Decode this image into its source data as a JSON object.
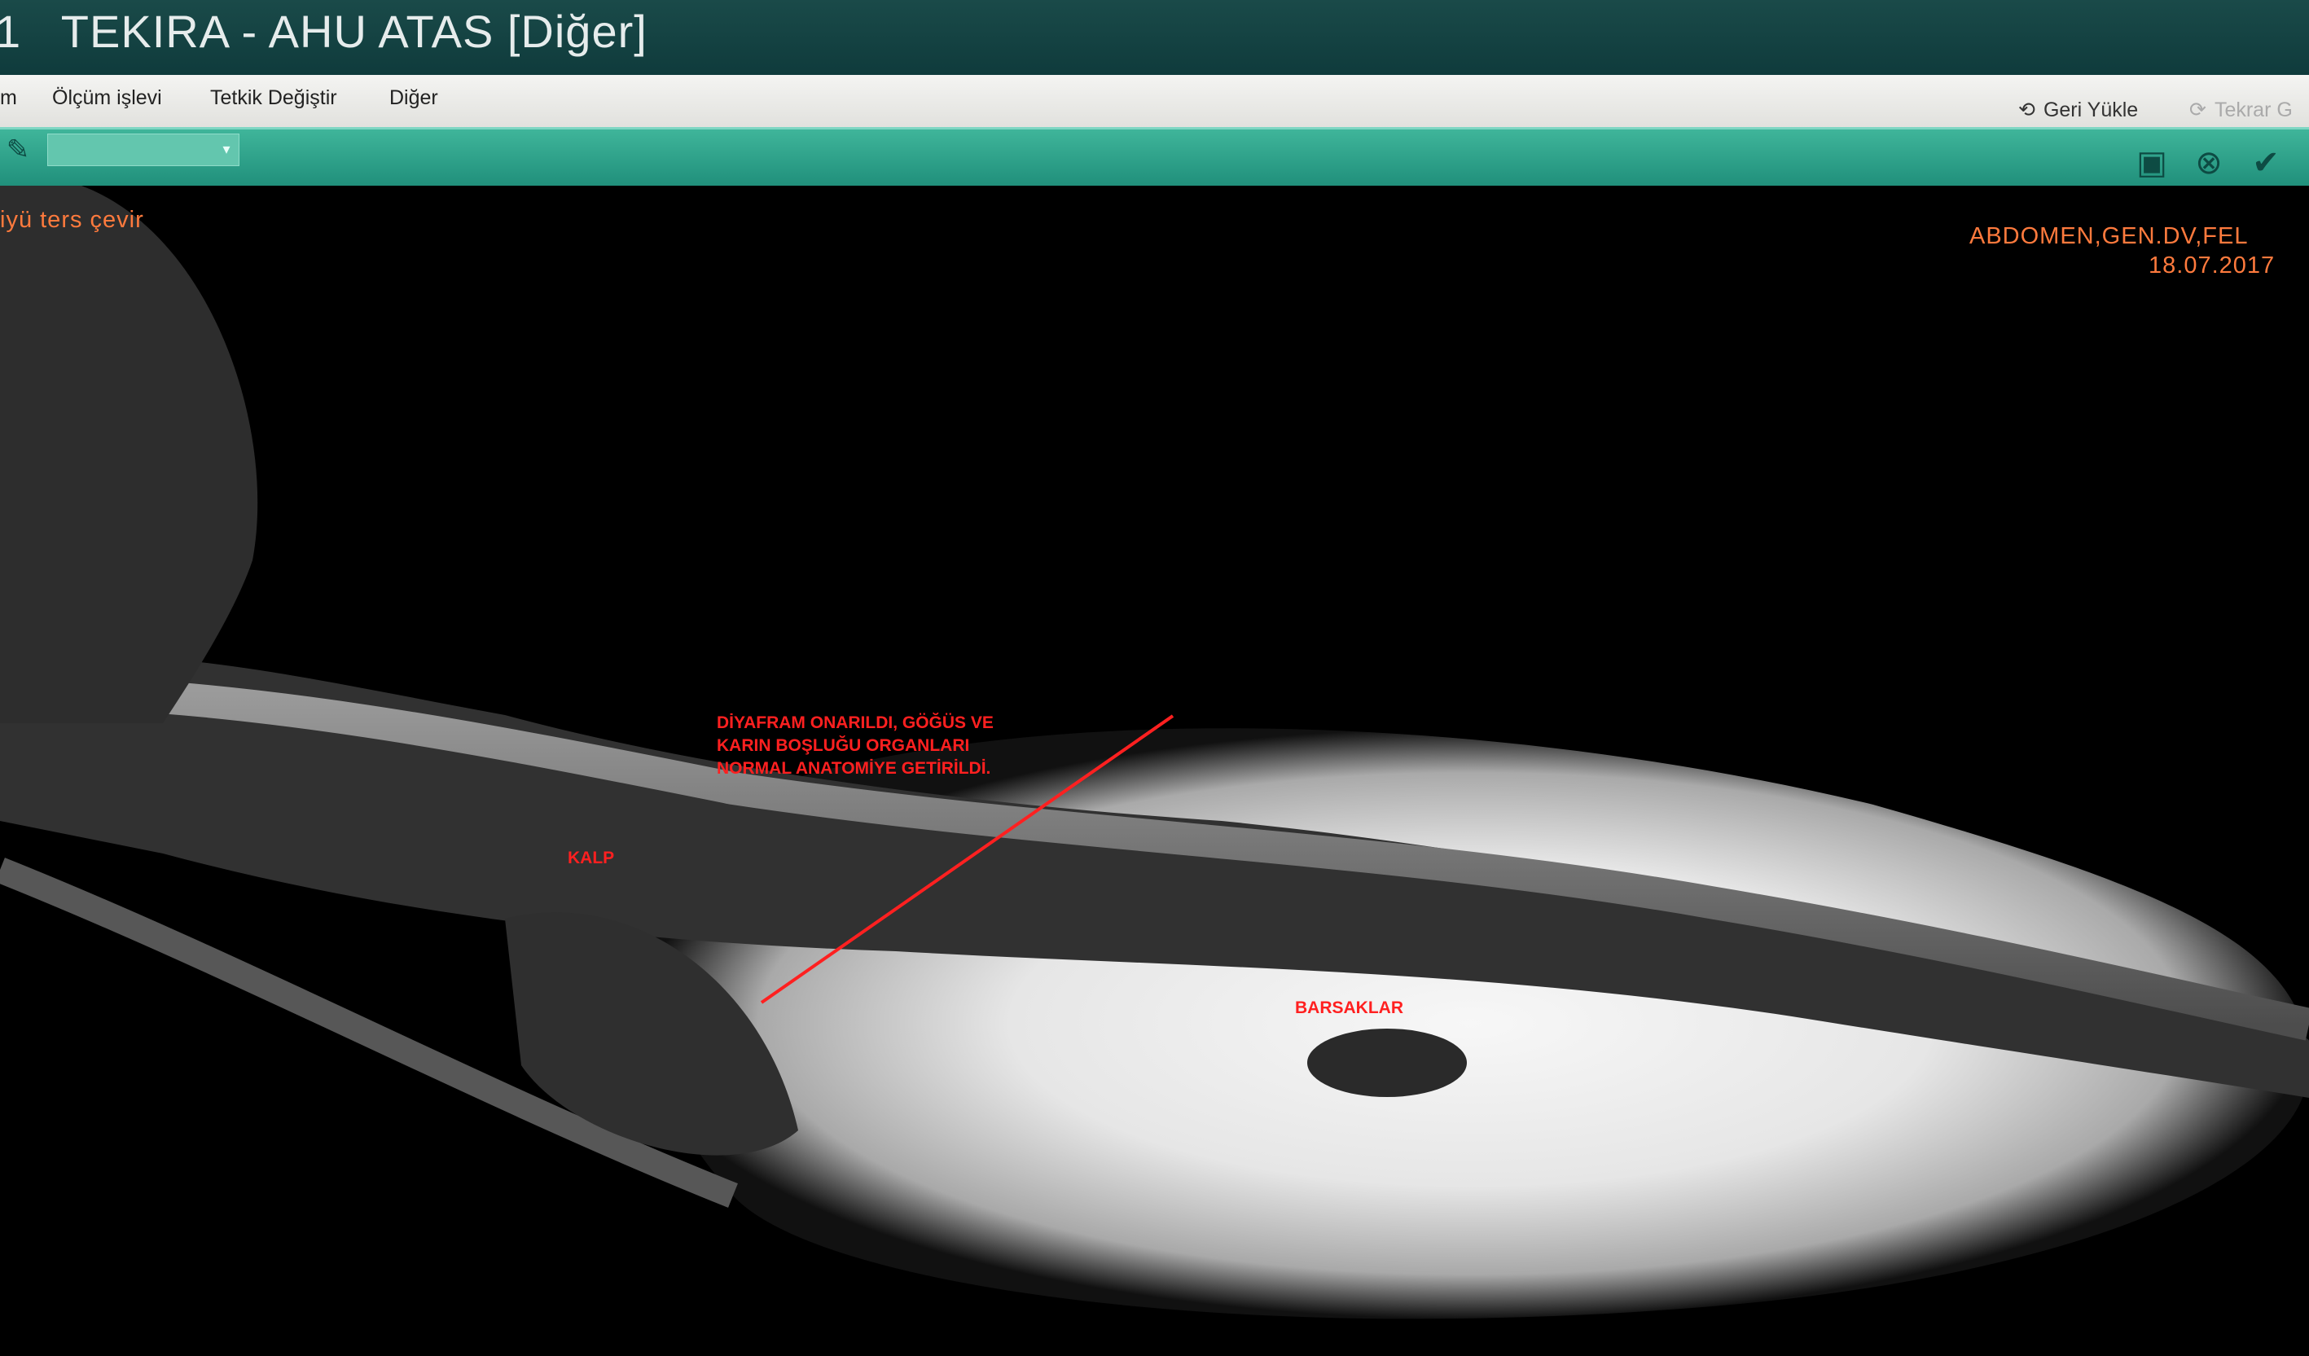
{
  "window": {
    "title": "1   TEKIRA - AHU ATAS [Diğer]"
  },
  "menu": {
    "items": [
      "m",
      "Ölçüm işlevi",
      "Tetkik Değiştir",
      "Diğer"
    ],
    "right": {
      "reload": "Geri Yükle",
      "repeat": "Tekrar G"
    }
  },
  "toolbar": {
    "combo_value": ""
  },
  "viewer": {
    "overlay_left": "iyü ters çevir",
    "study_name": "ABDOMEN,GEN.DV,FEL",
    "study_date": "18.07.2017"
  },
  "annotations": {
    "diaphragm": [
      "DİYAFRAM ONARILDI, GÖĞÜS VE",
      "KARIN BOŞLUĞU ORGANLARI",
      "NORMAL ANATOMİYE GETİRİLDİ."
    ],
    "heart": "KALP",
    "intestines": "BARSAKLAR"
  },
  "colors": {
    "titlebar": "#134443",
    "toolbar": "#2aa58c",
    "overlay": "#ff7a3d",
    "annotation": "#ff2020"
  },
  "icons": [
    "edit-icon",
    "save-icon",
    "cancel-icon",
    "confirm-icon",
    "reload-icon",
    "repeat-icon"
  ]
}
